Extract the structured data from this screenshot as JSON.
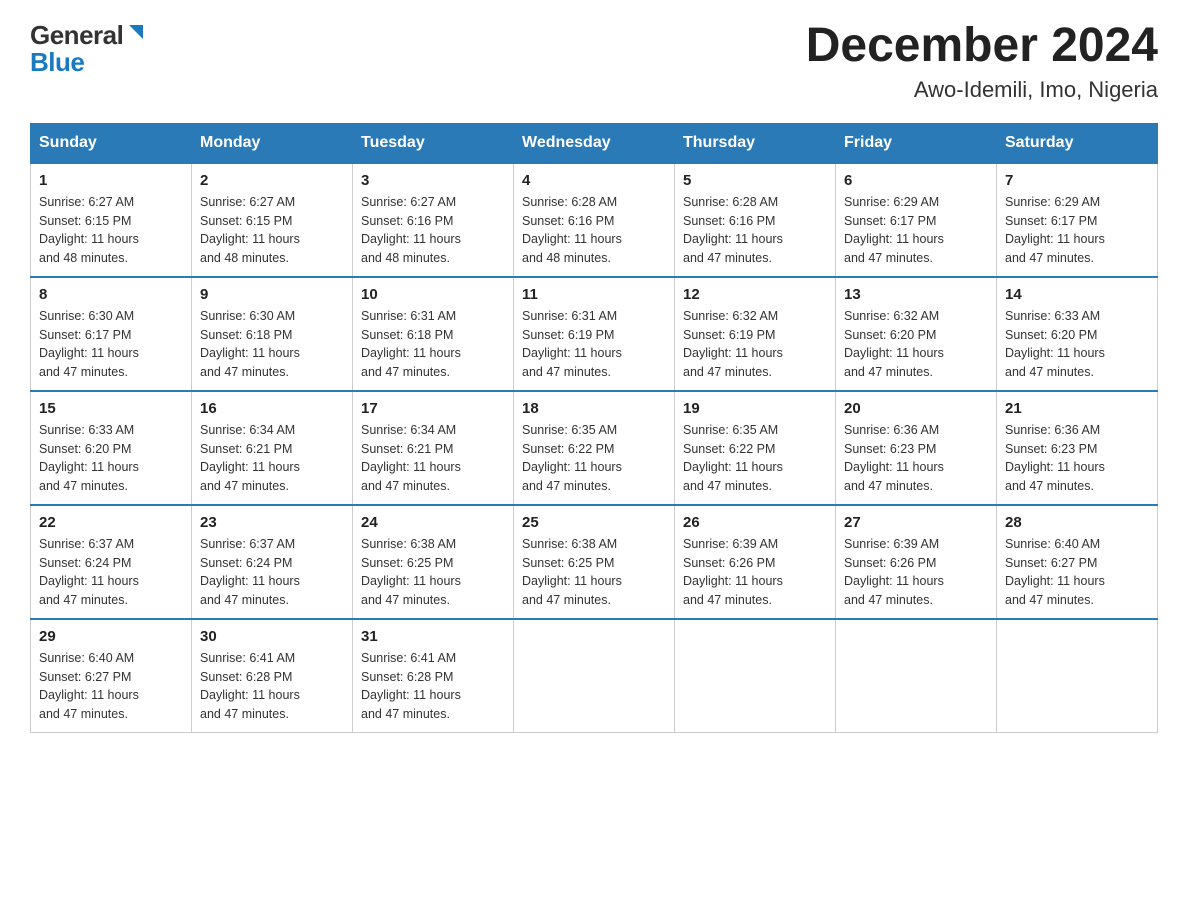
{
  "header": {
    "logo_general": "General",
    "logo_blue": "Blue",
    "month_year": "December 2024",
    "location": "Awo-Idemili, Imo, Nigeria"
  },
  "weekdays": [
    "Sunday",
    "Monday",
    "Tuesday",
    "Wednesday",
    "Thursday",
    "Friday",
    "Saturday"
  ],
  "weeks": [
    [
      {
        "day": "1",
        "sunrise": "6:27 AM",
        "sunset": "6:15 PM",
        "daylight": "11 hours and 48 minutes."
      },
      {
        "day": "2",
        "sunrise": "6:27 AM",
        "sunset": "6:15 PM",
        "daylight": "11 hours and 48 minutes."
      },
      {
        "day": "3",
        "sunrise": "6:27 AM",
        "sunset": "6:16 PM",
        "daylight": "11 hours and 48 minutes."
      },
      {
        "day": "4",
        "sunrise": "6:28 AM",
        "sunset": "6:16 PM",
        "daylight": "11 hours and 48 minutes."
      },
      {
        "day": "5",
        "sunrise": "6:28 AM",
        "sunset": "6:16 PM",
        "daylight": "11 hours and 47 minutes."
      },
      {
        "day": "6",
        "sunrise": "6:29 AM",
        "sunset": "6:17 PM",
        "daylight": "11 hours and 47 minutes."
      },
      {
        "day": "7",
        "sunrise": "6:29 AM",
        "sunset": "6:17 PM",
        "daylight": "11 hours and 47 minutes."
      }
    ],
    [
      {
        "day": "8",
        "sunrise": "6:30 AM",
        "sunset": "6:17 PM",
        "daylight": "11 hours and 47 minutes."
      },
      {
        "day": "9",
        "sunrise": "6:30 AM",
        "sunset": "6:18 PM",
        "daylight": "11 hours and 47 minutes."
      },
      {
        "day": "10",
        "sunrise": "6:31 AM",
        "sunset": "6:18 PM",
        "daylight": "11 hours and 47 minutes."
      },
      {
        "day": "11",
        "sunrise": "6:31 AM",
        "sunset": "6:19 PM",
        "daylight": "11 hours and 47 minutes."
      },
      {
        "day": "12",
        "sunrise": "6:32 AM",
        "sunset": "6:19 PM",
        "daylight": "11 hours and 47 minutes."
      },
      {
        "day": "13",
        "sunrise": "6:32 AM",
        "sunset": "6:20 PM",
        "daylight": "11 hours and 47 minutes."
      },
      {
        "day": "14",
        "sunrise": "6:33 AM",
        "sunset": "6:20 PM",
        "daylight": "11 hours and 47 minutes."
      }
    ],
    [
      {
        "day": "15",
        "sunrise": "6:33 AM",
        "sunset": "6:20 PM",
        "daylight": "11 hours and 47 minutes."
      },
      {
        "day": "16",
        "sunrise": "6:34 AM",
        "sunset": "6:21 PM",
        "daylight": "11 hours and 47 minutes."
      },
      {
        "day": "17",
        "sunrise": "6:34 AM",
        "sunset": "6:21 PM",
        "daylight": "11 hours and 47 minutes."
      },
      {
        "day": "18",
        "sunrise": "6:35 AM",
        "sunset": "6:22 PM",
        "daylight": "11 hours and 47 minutes."
      },
      {
        "day": "19",
        "sunrise": "6:35 AM",
        "sunset": "6:22 PM",
        "daylight": "11 hours and 47 minutes."
      },
      {
        "day": "20",
        "sunrise": "6:36 AM",
        "sunset": "6:23 PM",
        "daylight": "11 hours and 47 minutes."
      },
      {
        "day": "21",
        "sunrise": "6:36 AM",
        "sunset": "6:23 PM",
        "daylight": "11 hours and 47 minutes."
      }
    ],
    [
      {
        "day": "22",
        "sunrise": "6:37 AM",
        "sunset": "6:24 PM",
        "daylight": "11 hours and 47 minutes."
      },
      {
        "day": "23",
        "sunrise": "6:37 AM",
        "sunset": "6:24 PM",
        "daylight": "11 hours and 47 minutes."
      },
      {
        "day": "24",
        "sunrise": "6:38 AM",
        "sunset": "6:25 PM",
        "daylight": "11 hours and 47 minutes."
      },
      {
        "day": "25",
        "sunrise": "6:38 AM",
        "sunset": "6:25 PM",
        "daylight": "11 hours and 47 minutes."
      },
      {
        "day": "26",
        "sunrise": "6:39 AM",
        "sunset": "6:26 PM",
        "daylight": "11 hours and 47 minutes."
      },
      {
        "day": "27",
        "sunrise": "6:39 AM",
        "sunset": "6:26 PM",
        "daylight": "11 hours and 47 minutes."
      },
      {
        "day": "28",
        "sunrise": "6:40 AM",
        "sunset": "6:27 PM",
        "daylight": "11 hours and 47 minutes."
      }
    ],
    [
      {
        "day": "29",
        "sunrise": "6:40 AM",
        "sunset": "6:27 PM",
        "daylight": "11 hours and 47 minutes."
      },
      {
        "day": "30",
        "sunrise": "6:41 AM",
        "sunset": "6:28 PM",
        "daylight": "11 hours and 47 minutes."
      },
      {
        "day": "31",
        "sunrise": "6:41 AM",
        "sunset": "6:28 PM",
        "daylight": "11 hours and 47 minutes."
      },
      null,
      null,
      null,
      null
    ]
  ],
  "labels": {
    "sunrise": "Sunrise:",
    "sunset": "Sunset:",
    "daylight": "Daylight:"
  }
}
